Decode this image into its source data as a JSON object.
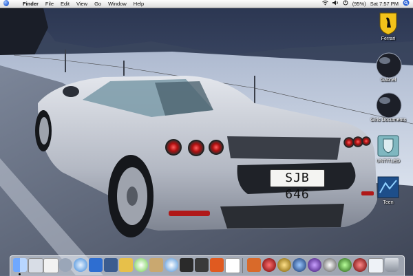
{
  "menubar": {
    "app_name": "Finder",
    "menus": [
      "File",
      "Edit",
      "View",
      "Go",
      "Window",
      "Help"
    ],
    "battery": "(95%)",
    "clock": "Sat 7:57 PM"
  },
  "desktop": {
    "icons": [
      {
        "label": "Ferrari",
        "icon": "ferrari-shield-icon"
      },
      {
        "label": "Gabriel",
        "icon": "dark-orb-icon"
      },
      {
        "label": "Giris Documents",
        "icon": "dark-orb-icon"
      },
      {
        "label": "UNTITLED",
        "icon": "shield-drive-icon"
      },
      {
        "label": "Teen",
        "icon": "blue-folder-icon"
      }
    ]
  },
  "dock": {
    "items": [
      "finder",
      "mail",
      "textedit",
      "system-preferences",
      "safari",
      "internet-explorer",
      "image-capture",
      "address-book",
      "itunes",
      "preview",
      "ichat",
      "imovie",
      "final-cut",
      "toast",
      "ical",
      "iphoto",
      "orb-red",
      "orb-gold",
      "orb-blue",
      "orb-purple",
      "orb-silver",
      "orb-green",
      "orb-dark",
      "orb-red-apple",
      "documents",
      "trash"
    ]
  },
  "colors": {
    "menubar_bg": "#e9e9e9",
    "sky": "#2e3b56",
    "snow": "#d9e2ee",
    "car_body": "#c4c8d0",
    "plate_text": "#111111"
  }
}
